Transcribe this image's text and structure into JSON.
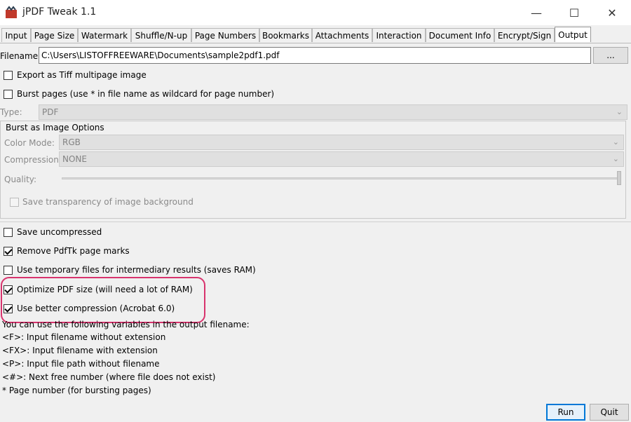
{
  "window": {
    "title": "jPDF Tweak 1.1",
    "minimize": "—",
    "maximize": "☐",
    "close": "✕"
  },
  "tabs": [
    {
      "label": "Input"
    },
    {
      "label": "Page Size"
    },
    {
      "label": "Watermark"
    },
    {
      "label": "Shuffle/N-up"
    },
    {
      "label": "Page Numbers"
    },
    {
      "label": "Bookmarks"
    },
    {
      "label": "Attachments"
    },
    {
      "label": "Interaction"
    },
    {
      "label": "Document Info"
    },
    {
      "label": "Encrypt/Sign"
    },
    {
      "label": "Output"
    }
  ],
  "active_tab": "Output",
  "output": {
    "filename_label": "Filename:",
    "filename_value": "C:\\Users\\LISTOFFREEWARE\\Documents\\sample2pdf1.pdf",
    "browse_label": "...",
    "export_tiff": {
      "label": "Export as Tiff multipage image",
      "checked": false
    },
    "burst_pages": {
      "label": "Burst pages (use * in file name as wildcard for page number)",
      "checked": false
    },
    "type_label": "Type:",
    "type_value": "PDF",
    "burst_group_title": "Burst as Image Options",
    "color_mode_label": "Color Mode:",
    "color_mode_value": "RGB",
    "compression_label": "Compression:",
    "compression_value": "NONE",
    "quality_label": "Quality:",
    "save_transparency": {
      "label": "Save transparency of image background",
      "checked": false
    },
    "save_uncompressed": {
      "label": "Save uncompressed",
      "checked": false
    },
    "remove_marks": {
      "label": "Remove PdfTk page marks",
      "checked": true
    },
    "temp_files": {
      "label": "Use temporary files for intermediary results (saves RAM)",
      "checked": false
    },
    "optimize": {
      "label": "Optimize PDF size (will need a lot of RAM)",
      "checked": true
    },
    "better_compression": {
      "label": "Use better compression (Acrobat 6.0)",
      "checked": true
    },
    "vars_intro": "You can use the following variables in the output filename:",
    "vars": [
      "<F>: Input filename without extension",
      "<FX>: Input filename with extension",
      "<P>: Input file path without filename",
      "<#>: Next free number (where file does not exist)",
      "* Page number (for bursting pages)"
    ]
  },
  "buttons": {
    "run": "Run",
    "quit": "Quit"
  },
  "colors": {
    "highlight": "#d8336d",
    "accent_border": "#0078d7"
  }
}
